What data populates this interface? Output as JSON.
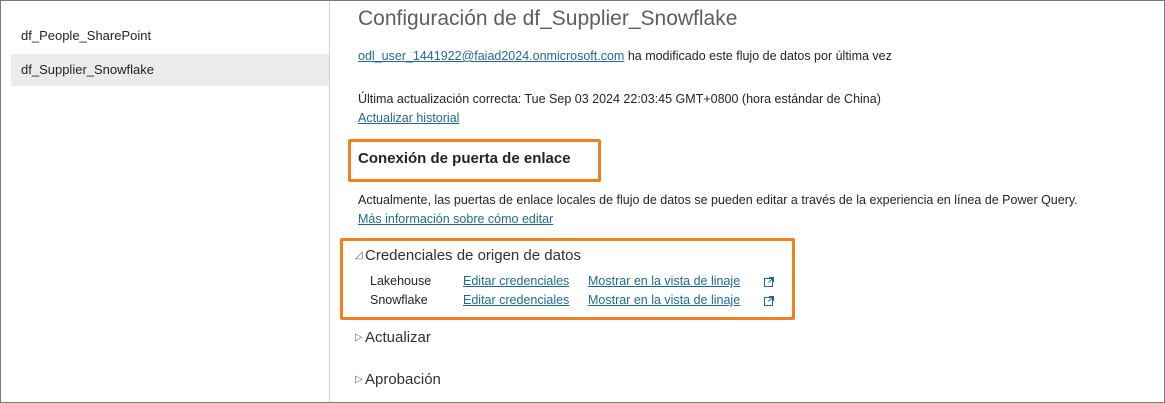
{
  "sidebar": {
    "items": [
      {
        "label": "df_People_SharePoint"
      },
      {
        "label": "df_Supplier_Snowflake"
      }
    ]
  },
  "main": {
    "title": "Configuración de df_Supplier_Snowflake",
    "modified_by_user": "odl_user_1441922@faiad2024.onmicrosoft.com",
    "modified_by_text": " ha modificado este flujo de datos por última vez",
    "last_refresh": "Última actualización correcta: Tue Sep 03 2024 22:03:45 GMT+0800 (hora estándar de China)",
    "refresh_history_link": "Actualizar historial",
    "gateway_heading": "Conexión de puerta de enlace",
    "gateway_text": "Actualmente, las puertas de enlace locales de flujo de datos se pueden editar a través de la experiencia en línea de Power Query.",
    "gateway_more_link": "Más información sobre cómo editar",
    "credentials_heading": "Credenciales de origen de datos",
    "credentials": [
      {
        "name": "Lakehouse",
        "edit_label": "Editar credenciales",
        "lineage_label": "Mostrar en la vista de linaje"
      },
      {
        "name": "Snowflake",
        "edit_label": "Editar credenciales",
        "lineage_label": "Mostrar en la vista de linaje"
      }
    ],
    "refresh_section": "Actualizar",
    "approval_section": "Aprobación"
  },
  "colors": {
    "highlight_border": "#f08020",
    "link": "#1f6b8f",
    "sidebar_selected": "#edebe9"
  }
}
